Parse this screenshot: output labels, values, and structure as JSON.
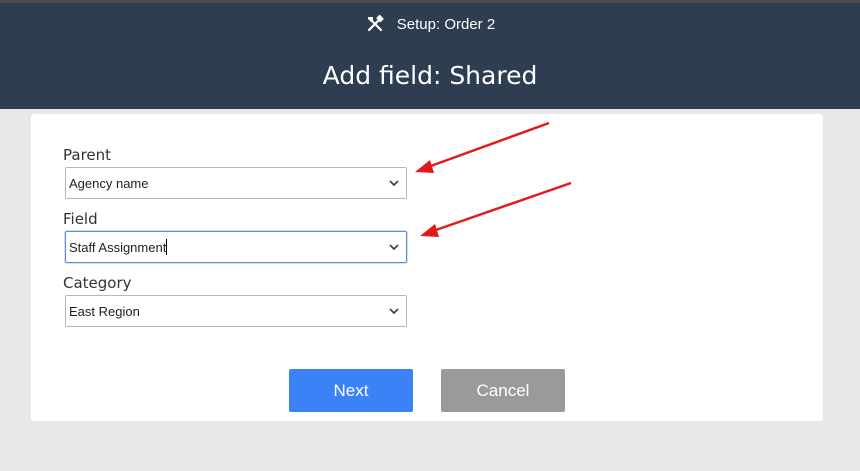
{
  "header": {
    "setup_title": "Setup: Order 2",
    "dialog_title": "Add field: Shared",
    "icon": "tools-icon"
  },
  "form": {
    "parent": {
      "label": "Parent",
      "value": "Agency name"
    },
    "field": {
      "label": "Field",
      "value": "Staff Assignment"
    },
    "category": {
      "label": "Category",
      "value": "East Region"
    }
  },
  "buttons": {
    "next": "Next",
    "cancel": "Cancel"
  },
  "colors": {
    "header_bg": "#2e3d52",
    "next_bg": "#3b82f6",
    "cancel_bg": "#9a9a9a",
    "annotation_arrow": "#e01b1b"
  }
}
